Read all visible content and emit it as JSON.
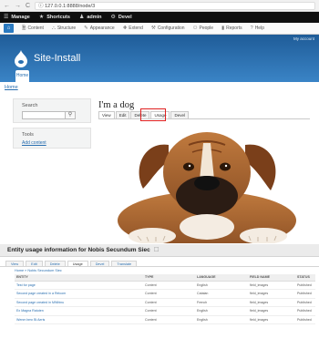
{
  "browser": {
    "nav_back": "←",
    "nav_forward": "→",
    "nav_reload": "C",
    "url": "ⓘ 127.0.0.1:8888/node/3"
  },
  "toolbar": {
    "manage": "Manage",
    "shortcuts": "Shortcuts",
    "user": "admin",
    "devel": "Devel"
  },
  "tray": {
    "items": [
      {
        "label": "Content",
        "icon": "content-icon",
        "glyph": "🗎"
      },
      {
        "label": "Structure",
        "icon": "structure-icon",
        "glyph": "⛬"
      },
      {
        "label": "Appearance",
        "icon": "appearance-icon",
        "glyph": "✎"
      },
      {
        "label": "Extend",
        "icon": "extend-icon",
        "glyph": "✚"
      },
      {
        "label": "Configuration",
        "icon": "wrench-icon",
        "glyph": "⚒"
      },
      {
        "label": "People",
        "icon": "people-icon",
        "glyph": "⚇"
      },
      {
        "label": "Reports",
        "icon": "reports-icon",
        "glyph": "▮"
      },
      {
        "label": "Help",
        "icon": "help-icon",
        "glyph": "?"
      }
    ]
  },
  "header": {
    "my_account": "My account",
    "site_name": "Site-Install",
    "home_tab": "Home"
  },
  "breadcrumb": "Home",
  "sidebar": {
    "search_title": "Search",
    "search_button": "⚲",
    "tools_title": "Tools",
    "tools_link": "Add content"
  },
  "node": {
    "title": "I'm a dog",
    "tabs": [
      "View",
      "Edit",
      "Delete",
      "Usage",
      "Devel"
    ]
  },
  "usage": {
    "heading": "Entity usage information for Nobis Secundum Siec",
    "close": "☐",
    "tabs": [
      "View",
      "Edit",
      "Delete",
      "Usage",
      "Devel",
      "Translate"
    ],
    "crumb": "Home » Nobis Secundum Siec",
    "columns": [
      "ENTITY",
      "TYPE",
      "LANGUAGE",
      "FIELD NAME",
      "STATUS"
    ],
    "rows": [
      {
        "entity": "Test for page",
        "type": "Content",
        "language": "English",
        "field": "field_images",
        "status": "Published"
      },
      {
        "entity": "Second page created in a Relcom",
        "type": "Content",
        "language": "Catalan",
        "field": "field_images",
        "status": "Published"
      },
      {
        "entity": "Second page created in MWbinu",
        "type": "Content",
        "language": "French",
        "field": "field_images",
        "status": "Published"
      },
      {
        "entity": "Ex Magna Ratuten",
        "type": "Content",
        "language": "English",
        "field": "field_images",
        "status": "Published"
      },
      {
        "entity": "Wenm bmx Bi Aeris",
        "type": "Content",
        "language": "English",
        "field": "field_images",
        "status": "Published"
      }
    ]
  },
  "colors": {
    "header_blue": "#2a6fb0",
    "toolbar": "#0f0f0f",
    "highlight_red": "#e02020"
  }
}
